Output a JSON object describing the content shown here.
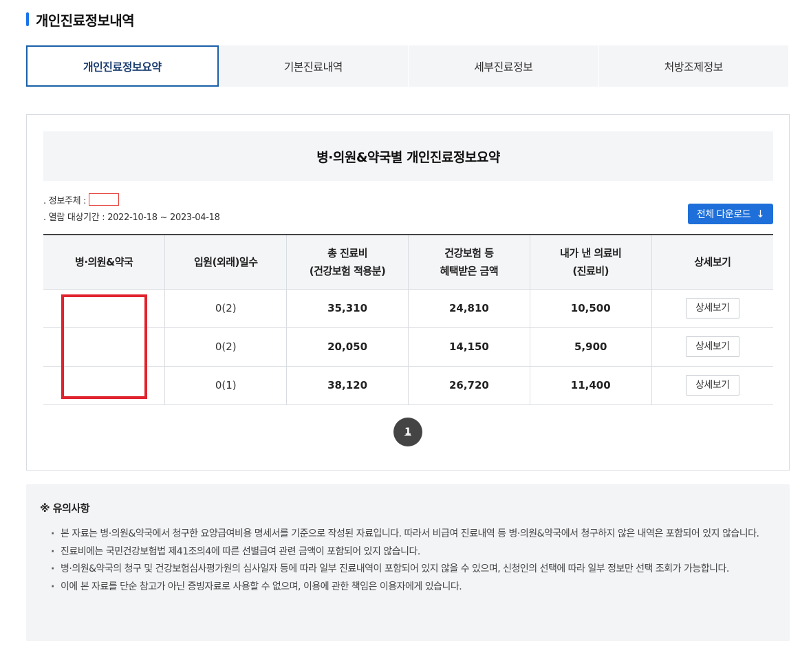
{
  "page_title": "개인진료정보내역",
  "tabs": [
    {
      "label": "개인진료정보요약",
      "active": true
    },
    {
      "label": "기본진료내역",
      "active": false
    },
    {
      "label": "세부진료정보",
      "active": false
    },
    {
      "label": "처방조제정보",
      "active": false
    }
  ],
  "summary": {
    "heading": "병·의원&약국별 개인진료정보요약",
    "subject_label": ". 정보주체 :",
    "period_label": ". 열람 대상기간 : 2022-10-18 ~ 2023-04-18",
    "download_label": "전체 다운로드",
    "download_icon": "arrow-down-icon"
  },
  "table": {
    "headers": {
      "hospital": "병·의원&약국",
      "days": "입원(외래)일수",
      "total_line1": "총 진료비",
      "total_line2": "(건강보험 적용분)",
      "benefit_line1": "건강보험 등",
      "benefit_line2": "혜택받은 금액",
      "mine_line1": "내가 낸 의료비",
      "mine_line2": "(진료비)",
      "detail": "상세보기"
    },
    "rows": [
      {
        "days": "0(2)",
        "total": "35,310",
        "benefit": "24,810",
        "mine": "10,500",
        "detail": "상세보기"
      },
      {
        "days": "0(2)",
        "total": "20,050",
        "benefit": "14,150",
        "mine": "5,900",
        "detail": "상세보기"
      },
      {
        "days": "0(1)",
        "total": "38,120",
        "benefit": "26,720",
        "mine": "11,400",
        "detail": "상세보기"
      }
    ]
  },
  "pagination": {
    "current": "1"
  },
  "notice": {
    "title": "※ 유의사항",
    "items": [
      "본 자료는 병·의원&약국에서 청구한 요양급여비용 명세서를 기준으로 작성된 자료입니다. 따라서 비급여 진료내역 등 병·의원&약국에서 청구하지 않은 내역은 포함되어 있지 않습니다.",
      "진료비에는 국민건강보험법 제41조의4에 따른 선별급여 관련 금액이 포함되어 있지 않습니다.",
      "병·의원&약국의 청구 및 건강보험심사평가원의 심사일자 등에 따라 일부 진료내역이 포함되어 있지 않을 수 있으며, 신청인의 선택에 따라 일부 정보만 선택 조회가 가능합니다.",
      "이에 본 자료를 단순 참고가 아닌 증빙자료로 사용할 수 없으며, 이용에 관한 책임은 이용자에게 있습니다."
    ]
  },
  "colors": {
    "accent": "#1e6fd9",
    "redaction": "#e0232e",
    "tab_active_border": "#1a5fa8"
  }
}
